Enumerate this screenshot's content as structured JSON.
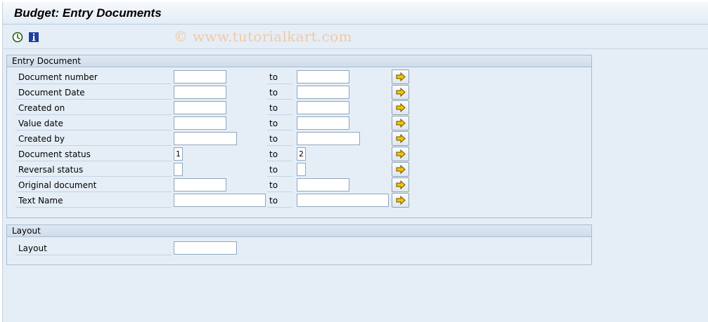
{
  "title": "Budget: Entry Documents",
  "watermark": "© www.tutorialkart.com",
  "toolbar": {
    "execute_icon": "execute-icon",
    "info_icon": "information-icon"
  },
  "groups": {
    "entry_document": {
      "heading": "Entry Document",
      "to_label": "to",
      "rows": [
        {
          "label": "Document number",
          "low": "",
          "high": ""
        },
        {
          "label": "Document Date",
          "low": "",
          "high": ""
        },
        {
          "label": "Created on",
          "low": "",
          "high": ""
        },
        {
          "label": "Value date",
          "low": "",
          "high": ""
        },
        {
          "label": "Created by",
          "low": "",
          "high": ""
        },
        {
          "label": "Document status",
          "low": "1",
          "high": "2"
        },
        {
          "label": "Reversal status",
          "low": "",
          "high": ""
        },
        {
          "label": "Original document",
          "low": "",
          "high": ""
        },
        {
          "label": "Text Name",
          "low": "",
          "high": ""
        }
      ]
    },
    "layout": {
      "heading": "Layout",
      "label": "Layout",
      "value": ""
    }
  },
  "colors": {
    "background": "#e5eef7",
    "group_border": "#a9bccf",
    "arrow_button": "#f5c400",
    "watermark": "#f2c9a6"
  }
}
